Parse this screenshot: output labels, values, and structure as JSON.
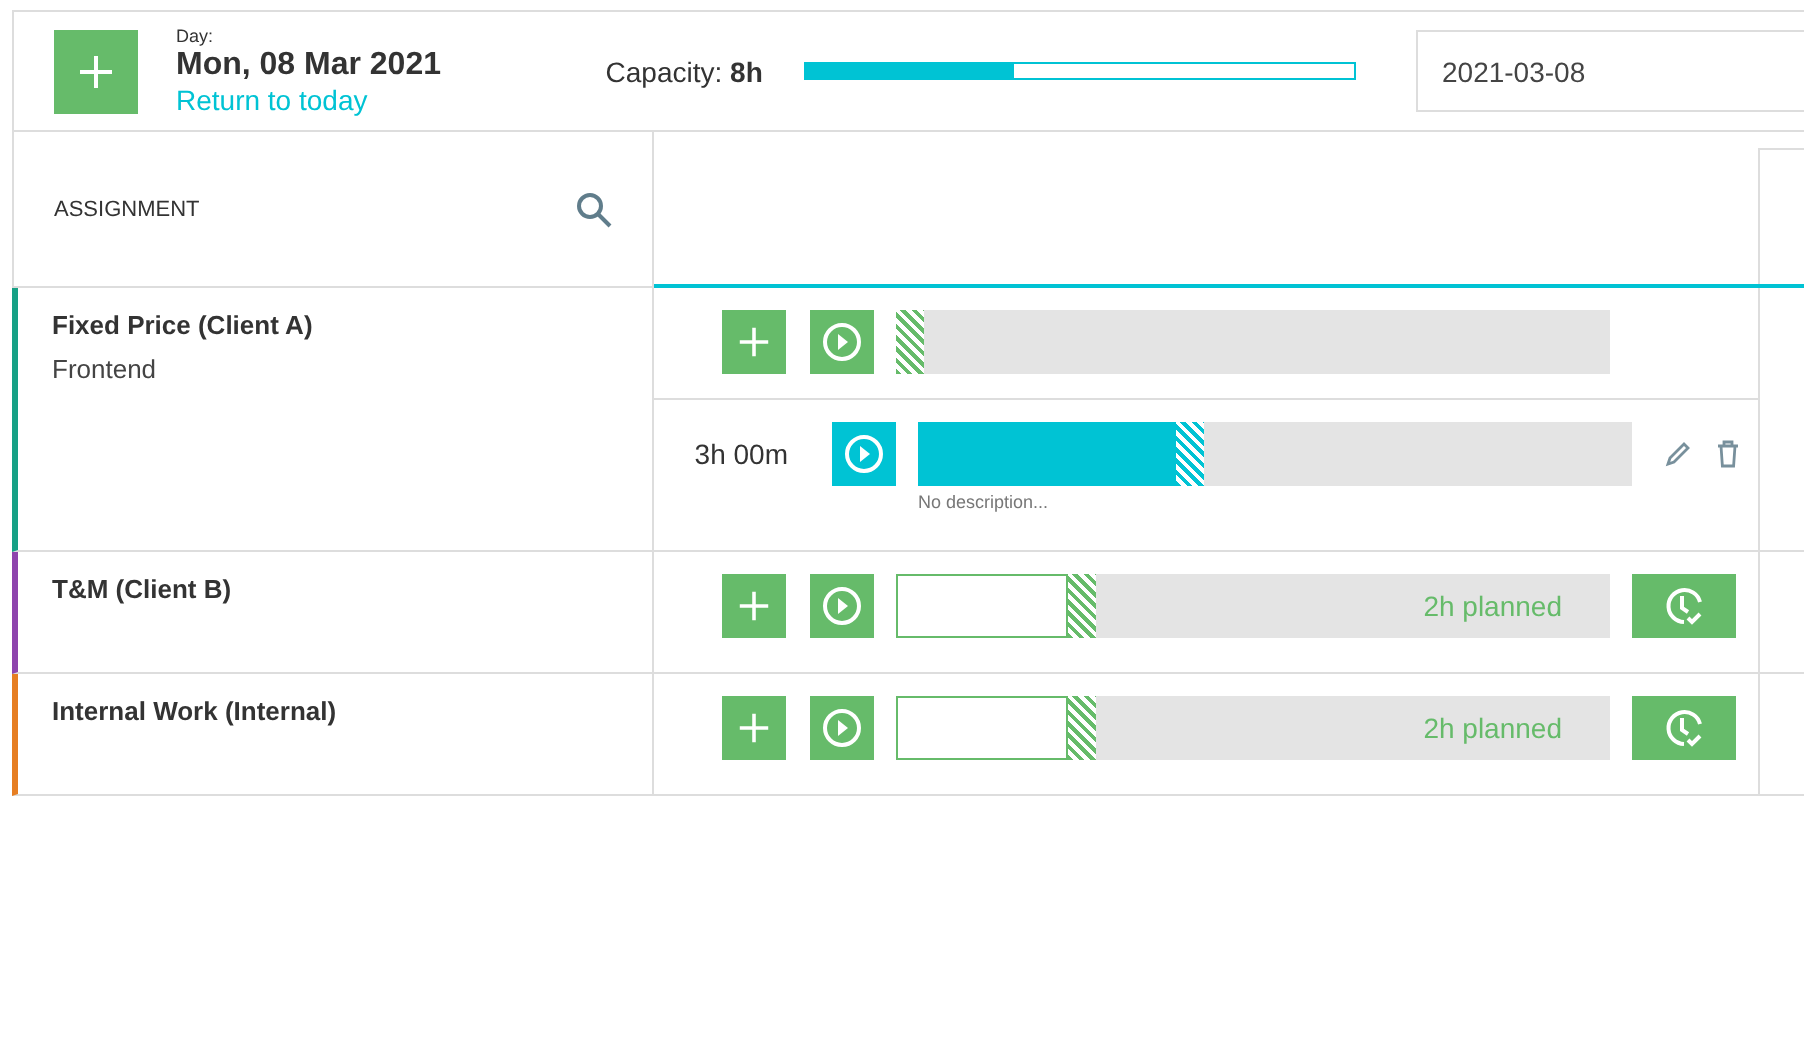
{
  "header": {
    "day_label": "Day:",
    "date": "Mon, 08 Mar 2021",
    "return_link": "Return to today",
    "capacity": {
      "label": "Capacity:",
      "value": "8h",
      "level": 0.38
    },
    "date_field": "2021-03-08"
  },
  "table": {
    "column_header": "ASSIGNMENT"
  },
  "assignments": [
    {
      "name": "Fixed Price (Client A)",
      "subtitle": "Frontend",
      "color": "#16a085",
      "entries": [
        {
          "kind": "add",
          "level": 0
        },
        {
          "kind": "logged",
          "duration": "3h 00m",
          "level": 0.36,
          "description": "No description..."
        }
      ]
    },
    {
      "name": "T&M (Client B)",
      "color": "#8e44ad",
      "entries": [
        {
          "kind": "add",
          "level": 0.24,
          "planned": "2h planned"
        }
      ]
    },
    {
      "name": "Internal Work (Internal)",
      "color": "#e67e22",
      "entries": [
        {
          "kind": "add",
          "level": 0.24,
          "planned": "2h planned"
        }
      ]
    }
  ]
}
